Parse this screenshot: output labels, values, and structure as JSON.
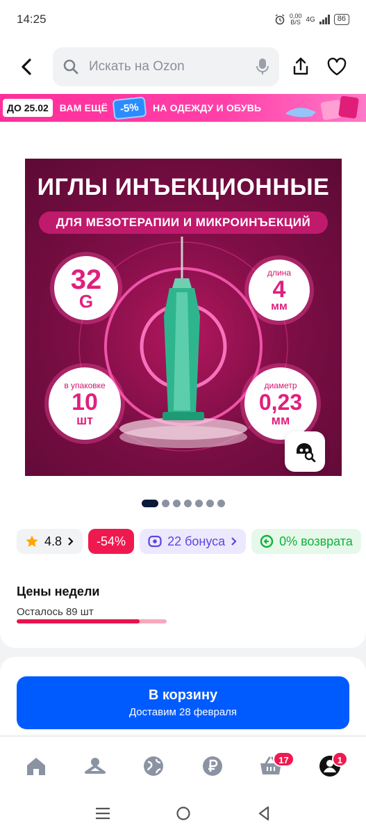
{
  "status": {
    "time": "14:25",
    "net_speed_value": "0,00",
    "net_speed_unit": "B/S",
    "network": "4G",
    "battery": "86"
  },
  "search": {
    "placeholder": "Искать на Ozon"
  },
  "promo": {
    "until": "ДО 25.02",
    "text1": "ВАМ ЕЩЁ",
    "discount": "-5%",
    "text2": "НА ОДЕЖДУ И ОБУВЬ"
  },
  "product_image": {
    "title": "ИГЛЫ ИНЪЕКЦИОННЫЕ",
    "subtitle": "ДЛЯ МЕЗОТЕРАПИИ И МИКРОИНЪЕКЦИЙ",
    "gauge_value": "32",
    "gauge_unit": "G",
    "length_label": "длина",
    "length_value": "4",
    "length_unit": "мм",
    "pack_label": "в упаковке",
    "pack_value": "10",
    "pack_unit": "шт",
    "diameter_label": "диаметр",
    "diameter_value": "0,23",
    "diameter_unit": "мм"
  },
  "gallery": {
    "total_images": 7,
    "active_index": 0
  },
  "chips": {
    "rating": "4.8",
    "discount": "-54%",
    "bonus": "22 бонуса",
    "return": "0% возврата"
  },
  "week_prices": {
    "title": "Цены недели",
    "remaining": "Осталось 89 шт",
    "progress_fraction": 0.82
  },
  "cart": {
    "button_label": "В корзину",
    "delivery": "Доставим 28 февраля"
  },
  "tabbar": {
    "cart_badge": "17",
    "profile_badge": "1"
  },
  "colors": {
    "accent": "#005bff",
    "discount": "#f0194f",
    "bonus": "#5b46e0",
    "return": "#10b23b"
  }
}
